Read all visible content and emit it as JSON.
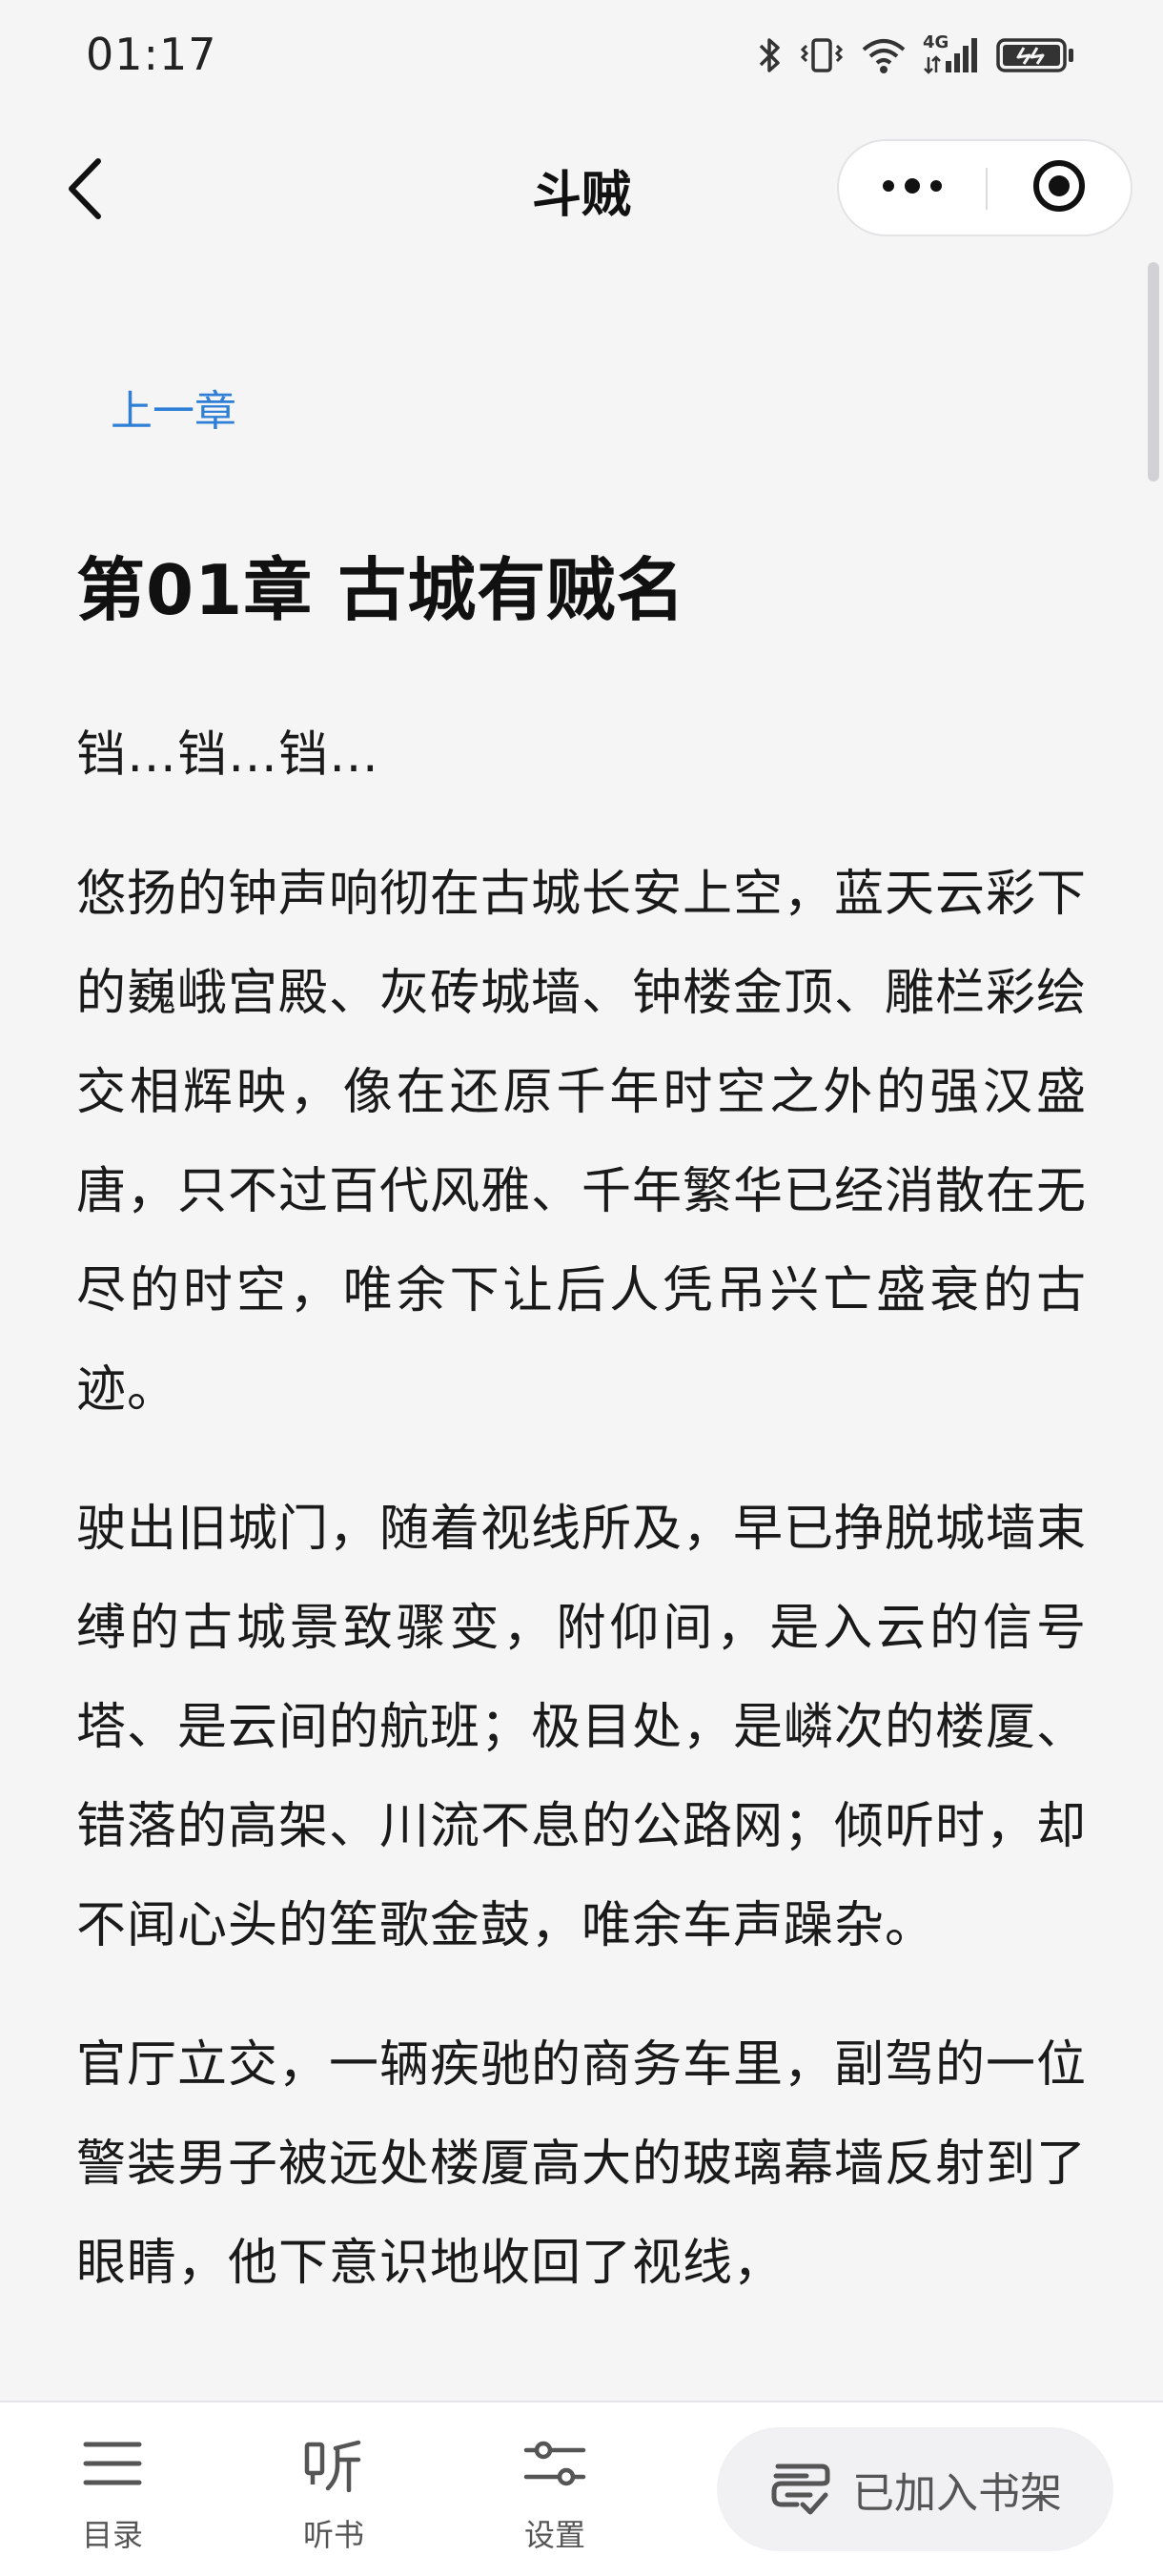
{
  "status_bar": {
    "time": "01:17",
    "network": "4G"
  },
  "nav": {
    "title": "斗贼",
    "back_icon": "chevron-left-icon",
    "more_icon": "more-dots-icon",
    "close_icon": "target-close-icon"
  },
  "reader": {
    "prev_chapter": "上一章",
    "chapter_title": "第01章 古城有贼名",
    "paragraphs": [
      "铛…铛…铛…",
      "悠扬的钟声响彻在古城长安上空，蓝天云彩下的巍峨宫殿、灰砖城墙、钟楼金顶、雕栏彩绘交相辉映，像在还原千年时空之外的强汉盛唐，只不过百代风雅、千年繁华已经消散在无尽的时空，唯余下让后人凭吊兴亡盛衰的古迹。",
      "驶出旧城门，随着视线所及，早已挣脱城墙束缚的古城景致骤变，附仰间，是入云的信号塔、是云间的航班；极目处，是嶙次的楼厦、错落的高架、川流不息的公路网；倾听时，却不闻心头的笙歌金鼓，唯余车声躁杂。",
      "官厅立交，一辆疾驰的商务车里，副驾的一位警装男子被远处楼厦高大的玻璃幕墙反射到了眼睛，他下意识地收回了视线，"
    ]
  },
  "bottom_bar": {
    "tabs": [
      {
        "label": "目录",
        "icon": "menu-icon"
      },
      {
        "label": "听书",
        "icon": "listen-icon"
      },
      {
        "label": "设置",
        "icon": "settings-sliders-icon"
      }
    ],
    "shelf_button": {
      "label": "已加入书架",
      "icon": "bookshelf-icon"
    }
  },
  "colors": {
    "accent_link": "#2f7fd6",
    "background": "#f5f5f6",
    "text": "#1a1a1a"
  }
}
